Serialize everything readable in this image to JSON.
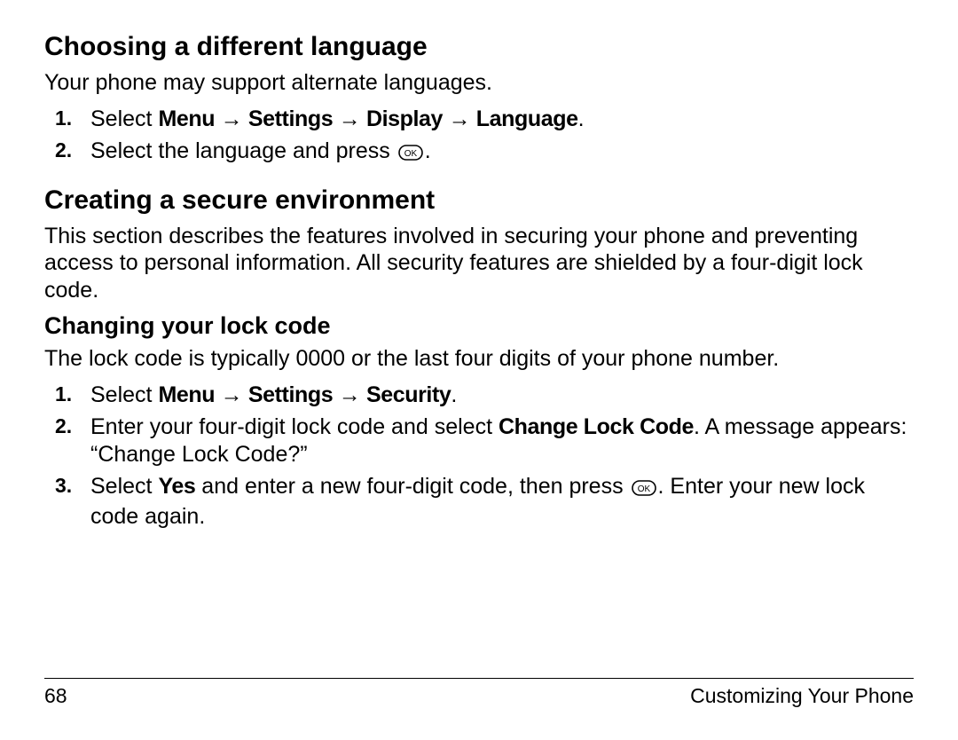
{
  "sec1": {
    "heading": "Choosing a different language",
    "intro": "Your phone may support alternate languages.",
    "items": [
      {
        "num": "1.",
        "pre": "Select ",
        "nav1": "Menu",
        "nav2": "Settings",
        "nav3": "Display",
        "nav4": "Language",
        "post": "."
      },
      {
        "num": "2.",
        "pre": "Select the language and press ",
        "post": "."
      }
    ]
  },
  "sec2": {
    "heading": "Creating a secure environment",
    "intro": "This section describes the features involved in securing your phone and preventing access to personal information. All security features are shielded by a four-digit lock code."
  },
  "sec3": {
    "heading": "Changing your lock code",
    "intro": "The lock code is typically 0000 or the last four digits of your phone number.",
    "items": [
      {
        "num": "1.",
        "pre": "Select ",
        "nav1": "Menu",
        "nav2": "Settings",
        "nav3": "Security",
        "post": "."
      },
      {
        "num": "2.",
        "pre": "Enter your four-digit lock code and select ",
        "bold1": "Change Lock Code",
        "post": ". A message appears: “Change Lock Code?”"
      },
      {
        "num": "3.",
        "pre": "Select ",
        "bold1": "Yes",
        "mid": " and enter a new four-digit code, then press ",
        "post": ". Enter your new lock code again."
      }
    ]
  },
  "arrow": "→",
  "footer": {
    "page": "68",
    "section": "Customizing Your Phone"
  }
}
